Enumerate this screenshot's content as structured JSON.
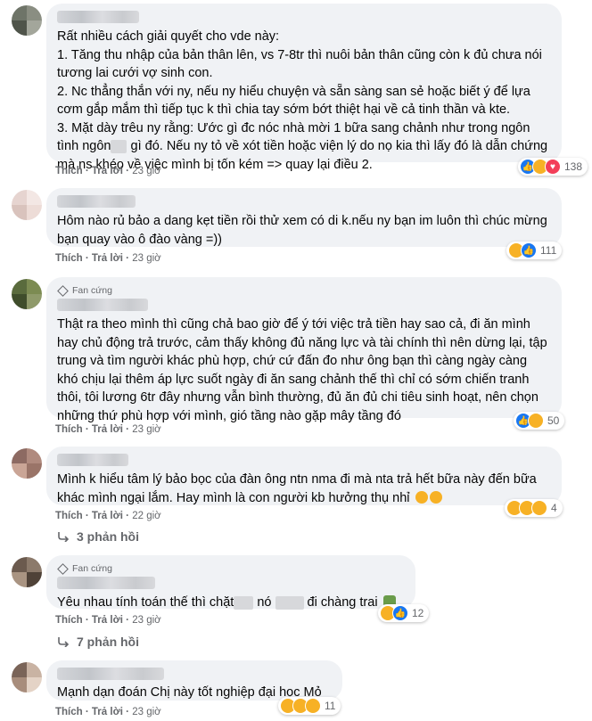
{
  "actions": {
    "like": "Thích",
    "reply": "Trả lời",
    "sep": "·"
  },
  "comments": [
    {
      "lines": "Rất nhiều cách giải quyết cho vde này:\n1. Tăng thu nhập của bản thân lên, vs 7-8tr thì nuôi bản thân cũng còn k đủ chưa nói tương lai cưới vợ sinh con.\n2. Nc thẳng thắn với ny, nếu ny hiểu chuyện và sẵn sàng san sẻ hoặc biết ý để lựa cơm gắp mắm thì tiếp tục k thì chia tay sớm bớt thiệt hại về cả tinh thần và kte.\n3. Mặt dày trêu ny rằng: Ước gì đc nóc nhà mời 1 bữa sang chảnh như trong ngôn tình ngôn",
      "tail": " gì đó. Nếu ny tỏ về xót tiền hoặc viện lý do nọ kia thì lấy đó là dẫn chứng mà ns khéo về việc mình bị tốn kém => quay lại điều 2.",
      "time": "23 giờ",
      "reactions": [
        "like",
        "haha",
        "love"
      ],
      "count": "138"
    },
    {
      "lines": "Hôm nào rủ bảo a dang kẹt tiền rồi thử xem có di k.nếu ny bạn im luôn thì chúc mừng bạn quay vào ô đào vàng =))",
      "time": "23 giờ",
      "reactions": [
        "haha",
        "like"
      ],
      "count": "111"
    },
    {
      "badge": "Fan cứng",
      "lines": "Thật ra theo mình thì cũng chả bao giờ để ý tới việc trả tiền hay sao cả, đi ăn mình hay chủ động trả trước, cảm thấy không đủ năng lực và tài chính thì nên dừng lại, tập trung và tìm người khác phù hợp, chứ cứ đấn đo như ông bạn thì càng ngày càng khó chịu lại thêm áp lực suốt ngày đi ăn sang chảnh thế thì chỉ có sớm chiến tranh thôi, tôi lương 6tr đây nhưng vẫn bình thường, đủ ăn đủ chi tiêu sinh hoạt, nên chọn những thứ phù hợp với mình, gió tầng nào gặp mây tầng đó",
      "time": "23 giờ",
      "reactions": [
        "like",
        "haha"
      ],
      "count": "50"
    },
    {
      "lines": "Mình k hiểu tâm lý bảo bọc của đàn ông ntn nma đi mà nta trả hết bữa này đến bữa khác mình ngại lắm. Hay mình là con người kb hưởng thụ nhỉ",
      "time": "22 giờ",
      "reactions": [
        "haha",
        "sad",
        "wow"
      ],
      "count": "4",
      "replies": "3 phản hồi"
    },
    {
      "badge": "Fan cứng",
      "lines": "Yêu nhau tính toán thế thì chặt",
      "mid": " nó ",
      "tail": " đi chàng trai",
      "time": "23 giờ",
      "reactions": [
        "haha",
        "like"
      ],
      "count": "12",
      "replies": "7 phản hồi"
    },
    {
      "lines": "Mạnh dạn đoán Chị này tốt nghiệp đại học Mỏ",
      "time": "23 giờ",
      "reactions": [
        "haha",
        "wow",
        "sad"
      ],
      "count": "11"
    }
  ]
}
